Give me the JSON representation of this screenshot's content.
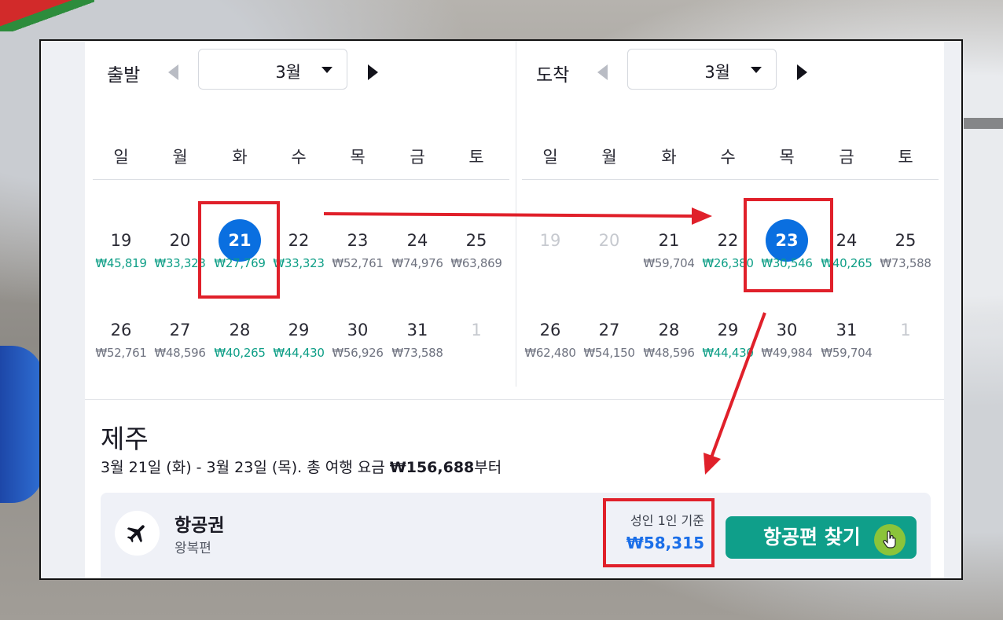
{
  "left_calendar": {
    "label": "출발",
    "month": "3월",
    "weekdays": [
      "일",
      "월",
      "화",
      "수",
      "목",
      "금",
      "토"
    ],
    "days": [
      {
        "d": "19",
        "p": "₩45,819",
        "cheap": true
      },
      {
        "d": "20",
        "p": "₩33,323",
        "cheap": true
      },
      {
        "d": "21",
        "p": "₩27,769",
        "cheap": true,
        "selected": true
      },
      {
        "d": "22",
        "p": "₩33,323",
        "cheap": true
      },
      {
        "d": "23",
        "p": "₩52,761",
        "cheap": false
      },
      {
        "d": "24",
        "p": "₩74,976",
        "cheap": false
      },
      {
        "d": "25",
        "p": "₩63,869",
        "cheap": false
      },
      {
        "d": "26",
        "p": "₩52,761",
        "cheap": false
      },
      {
        "d": "27",
        "p": "₩48,596",
        "cheap": false
      },
      {
        "d": "28",
        "p": "₩40,265",
        "cheap": true
      },
      {
        "d": "29",
        "p": "₩44,430",
        "cheap": true
      },
      {
        "d": "30",
        "p": "₩56,926",
        "cheap": false
      },
      {
        "d": "31",
        "p": "₩73,588",
        "cheap": false
      },
      {
        "d": "1",
        "p": "",
        "dim": true
      }
    ]
  },
  "right_calendar": {
    "label": "도착",
    "month": "3월",
    "weekdays": [
      "일",
      "월",
      "화",
      "수",
      "목",
      "금",
      "토"
    ],
    "days": [
      {
        "d": "19",
        "p": "",
        "dim": true
      },
      {
        "d": "20",
        "p": "",
        "dim": true
      },
      {
        "d": "21",
        "p": "₩59,704",
        "cheap": false
      },
      {
        "d": "22",
        "p": "₩26,380",
        "cheap": true
      },
      {
        "d": "23",
        "p": "₩30,546",
        "cheap": true,
        "selected": true
      },
      {
        "d": "24",
        "p": "₩40,265",
        "cheap": true
      },
      {
        "d": "25",
        "p": "₩73,588",
        "cheap": false
      },
      {
        "d": "26",
        "p": "₩62,480",
        "cheap": false
      },
      {
        "d": "27",
        "p": "₩54,150",
        "cheap": false
      },
      {
        "d": "28",
        "p": "₩48,596",
        "cheap": false
      },
      {
        "d": "29",
        "p": "₩44,430",
        "cheap": true
      },
      {
        "d": "30",
        "p": "₩49,984",
        "cheap": false
      },
      {
        "d": "31",
        "p": "₩59,704",
        "cheap": false
      },
      {
        "d": "1",
        "p": "",
        "dim": true
      }
    ]
  },
  "destination": "제주",
  "summary": {
    "text": "3월 21일 (화) - 3월 23일 (목). 총 여행 요금 ",
    "price": "₩156,688",
    "suffix": "부터"
  },
  "flight": {
    "title": "항공권",
    "subtitle": "왕복편",
    "price_note": "성인 1인 기준",
    "price": "₩58,315",
    "button": "항공편 찾기"
  },
  "colors": {
    "accent_blue": "#0a6fe0",
    "cheap_green": "#0d9e86",
    "button_teal": "#0f9f8a",
    "annotation_red": "#e0202a"
  },
  "icons": [
    "chevron-left-icon",
    "chevron-right-icon",
    "caret-down-icon",
    "airplane-icon",
    "hand-cursor-icon"
  ]
}
